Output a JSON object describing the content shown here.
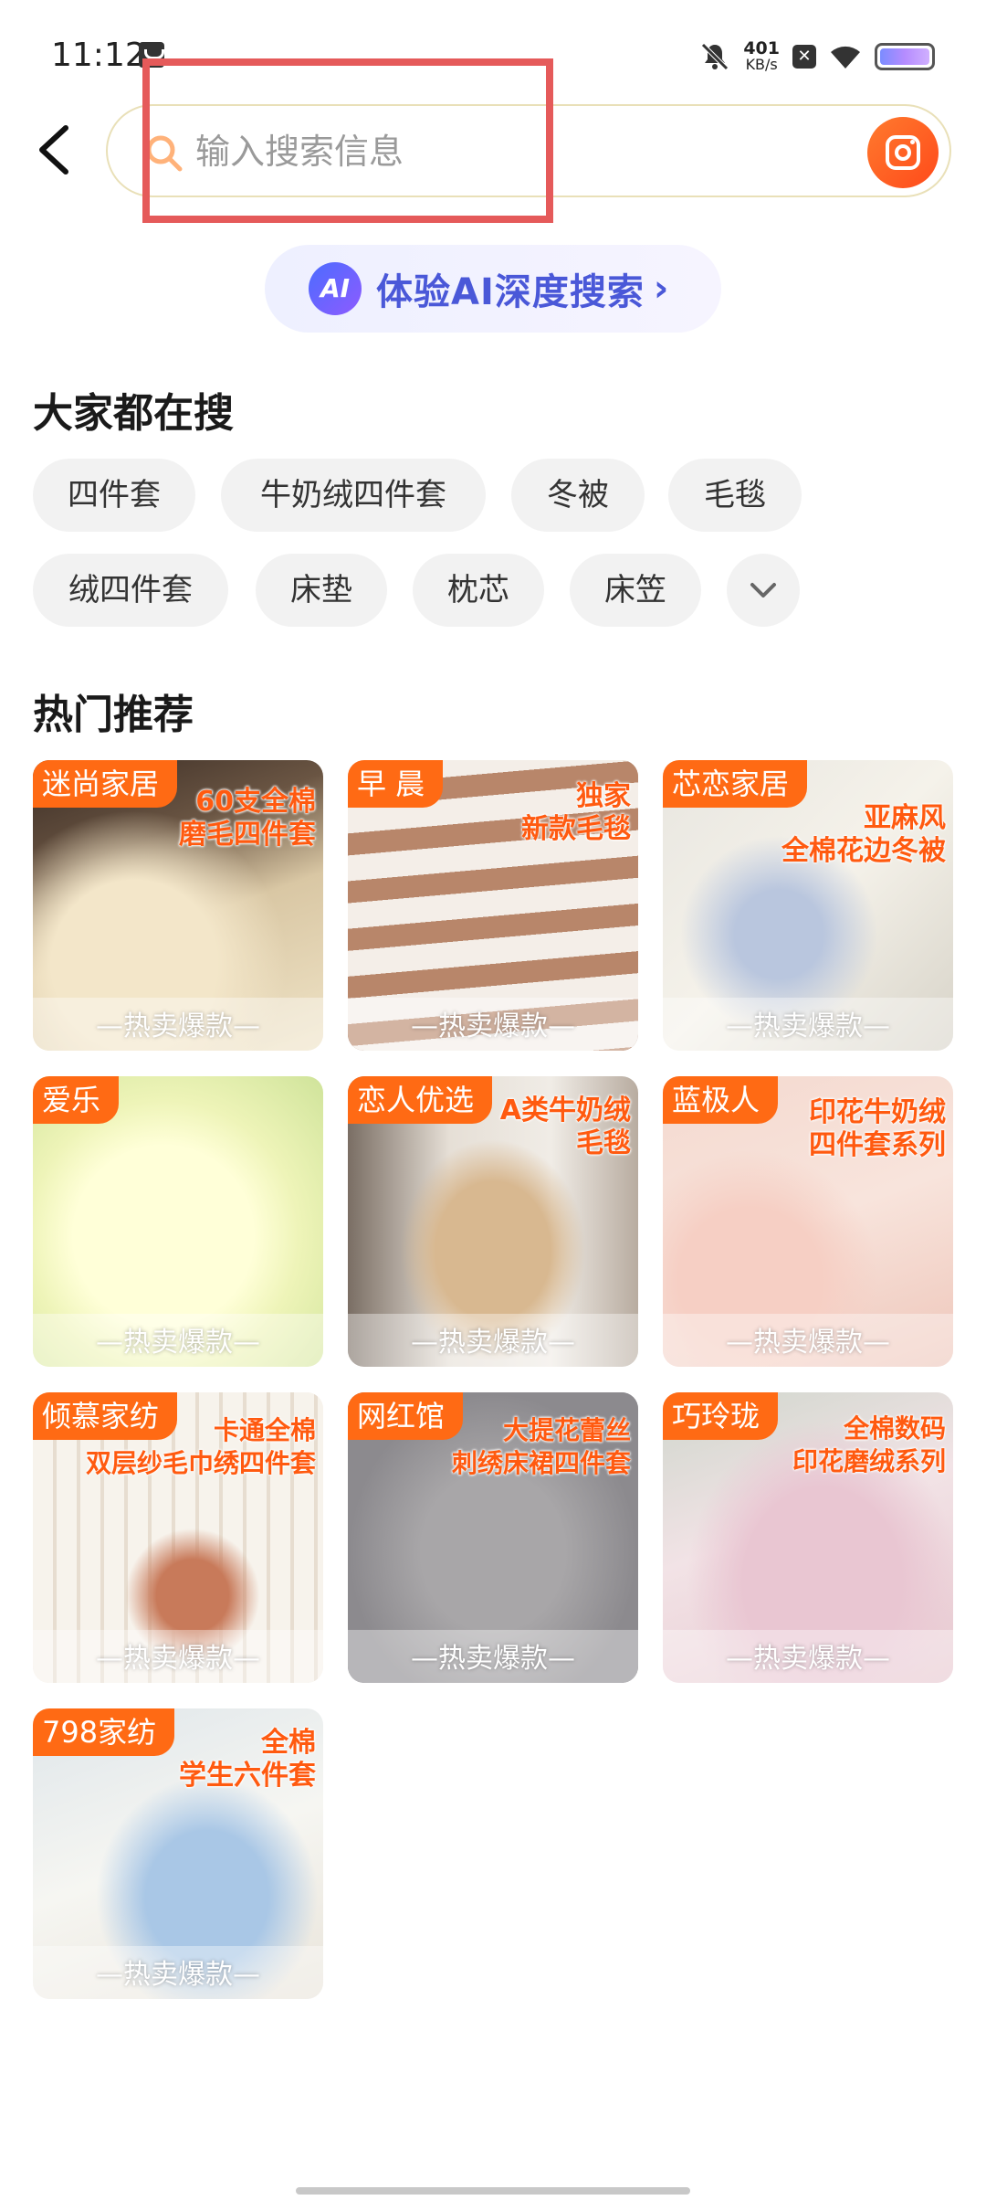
{
  "status_bar": {
    "time": "11:12",
    "net_speed_value": "401",
    "net_speed_unit": "KB/s"
  },
  "search": {
    "placeholder": "输入搜索信息",
    "value": ""
  },
  "ai_banner": {
    "logo": "AI",
    "label": "体验AI深度搜索"
  },
  "hot_searches": {
    "title": "大家都在搜",
    "chips": [
      "四件套",
      "牛奶绒四件套",
      "冬被",
      "毛毯",
      "绒四件套",
      "床垫",
      "枕芯",
      "床笠"
    ]
  },
  "recommend": {
    "title": "热门推荐",
    "hot_label": "—热卖爆款—",
    "items": [
      {
        "brand": "迷尚家居",
        "promo1": "60支全棉",
        "promo2": "磨毛四件套"
      },
      {
        "brand": "早 晨",
        "promo1": "独家",
        "promo2": "新款毛毯"
      },
      {
        "brand": "芯恋家居",
        "promo1": "亚麻风",
        "promo2": "全棉花边冬被"
      },
      {
        "brand": "爱乐",
        "promo1": "",
        "promo2": ""
      },
      {
        "brand": "恋人优选",
        "promo1": "A类牛奶绒",
        "promo2": "毛毯"
      },
      {
        "brand": "蓝极人",
        "promo1": "印花牛奶绒",
        "promo2": "四件套系列"
      },
      {
        "brand": "倾慕家纺",
        "promo1": "卡通全棉",
        "promo2": "双层纱毛巾绣四件套"
      },
      {
        "brand": "网红馆",
        "promo1": "大提花蕾丝",
        "promo2": "刺绣床裙四件套"
      },
      {
        "brand": "巧玲珑",
        "promo1": "全棉数码",
        "promo2": "印花磨绒系列"
      },
      {
        "brand": "798家纺",
        "promo1": "全棉",
        "promo2": "学生六件套"
      }
    ]
  },
  "colors": {
    "accent": "#ff6a14",
    "ai": "#4a58d8",
    "highlight": "#e55a5a"
  }
}
